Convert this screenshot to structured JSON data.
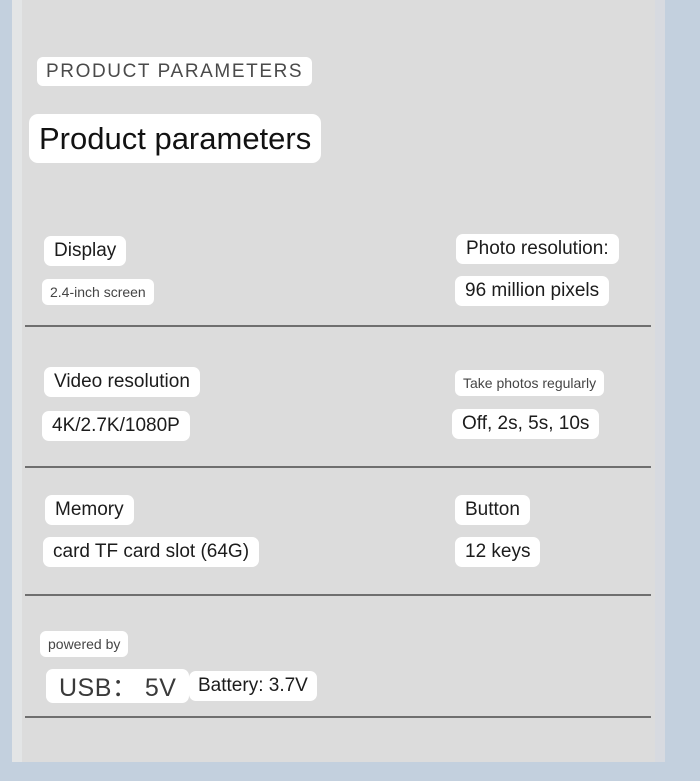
{
  "header": {
    "kicker": "PRODUCT PARAMETERS",
    "title": "Product parameters"
  },
  "specs": [
    {
      "left_label": "Display",
      "left_value": "2.4-inch screen",
      "right_label": "Photo resolution:",
      "right_value": "96 million pixels"
    },
    {
      "left_label": "Video resolution",
      "left_value": "4K/2.7K/1080P",
      "right_label": "Take photos regularly",
      "right_value": "Off, 2s, 5s, 10s"
    },
    {
      "left_label": "Memory",
      "left_value": "card TF card slot (64G)",
      "right_label": "Button",
      "right_value": "12 keys"
    }
  ],
  "power": {
    "label": "powered by",
    "usb": "USB： 5V",
    "battery": "Battery: 3.7V"
  },
  "colors": {
    "page_background": "#c3d0de",
    "panel_background": "#dcdcdc",
    "chip_background": "#ffffff",
    "text_primary": "#1c1c1c",
    "text_muted": "#454545",
    "divider": "#6f6f6f"
  }
}
